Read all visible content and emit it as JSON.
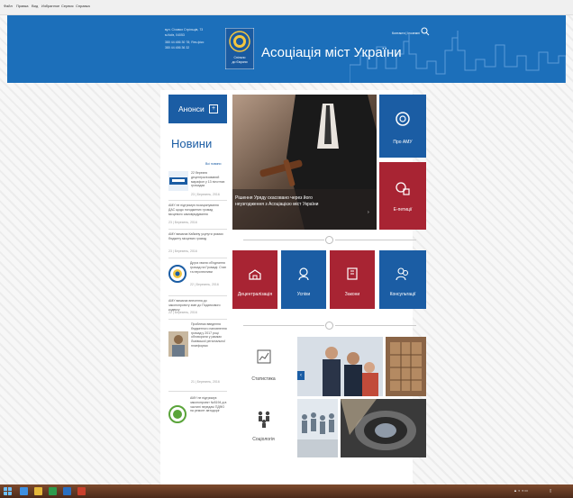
{
  "browser": {
    "menu": [
      "Файл",
      "Правка",
      "Вид",
      "Избранное",
      "Сервис",
      "Справка"
    ]
  },
  "header": {
    "address_lines": [
      "вул. Січових Стрільців, 73",
      "м.Київ, 04053",
      "380 44 486 30 78; Res.фікс",
      "380 44 486 36 32"
    ],
    "logo_text": [
      "Спільно",
      "до Європи"
    ],
    "title": "Асоціація міст України",
    "top_links": "Контакти | Іноземні",
    "search_icon": "search-icon"
  },
  "sidebar": {
    "anonsy_label": "Анонси",
    "anonsy_plus": "+",
    "news_heading": "Новини",
    "all_news": "Всі новини",
    "news": [
      "22 березня децентралізований марафон у 13 пілотних громадах",
      "АМУ не підтримує позиціонування ДАС щодо погоджених громад місцевого самоврядування",
      "АМУ вимагає Кабміну усунути ризики бюджету місцевих громад",
      "Друга хвиля об'єднання громад на Громаді: Стан та перспективи",
      "АМУ вимагає внесення до законопроекту змін до Податкового кодексу",
      "Проблеми введення бюджетного наповнення громад у 2017 році обговорили у рамках Львівської регіональної платформи",
      "АМУ не підтримує законопроект №5194-д в частині передачі ПДФО на ремонт автодоріг"
    ],
    "news_dates": [
      "23 | Березень, 2016",
      "23 | Березень, 2016",
      "23 | Березень, 2016",
      "22 | Березень, 2016",
      "22 | Березень, 2016",
      "21 | Березень, 2016",
      "21 | Березень, 2016"
    ]
  },
  "hero": {
    "caption": "Рішення Уряду скасовано через його неузгодження з Асоціацією міст України"
  },
  "tiles": {
    "about": "Про АМУ",
    "epetition": "Е-петиції",
    "decentralization": "Децентралізація",
    "successes": "Успіхи",
    "laws": "Закони",
    "consultations": "Консультації"
  },
  "bottom": {
    "statistics": "Статистика",
    "sociology": "Соціологія"
  },
  "colors": {
    "blue": "#1b5da4",
    "red": "#a82433",
    "header": "#1c6fba"
  }
}
